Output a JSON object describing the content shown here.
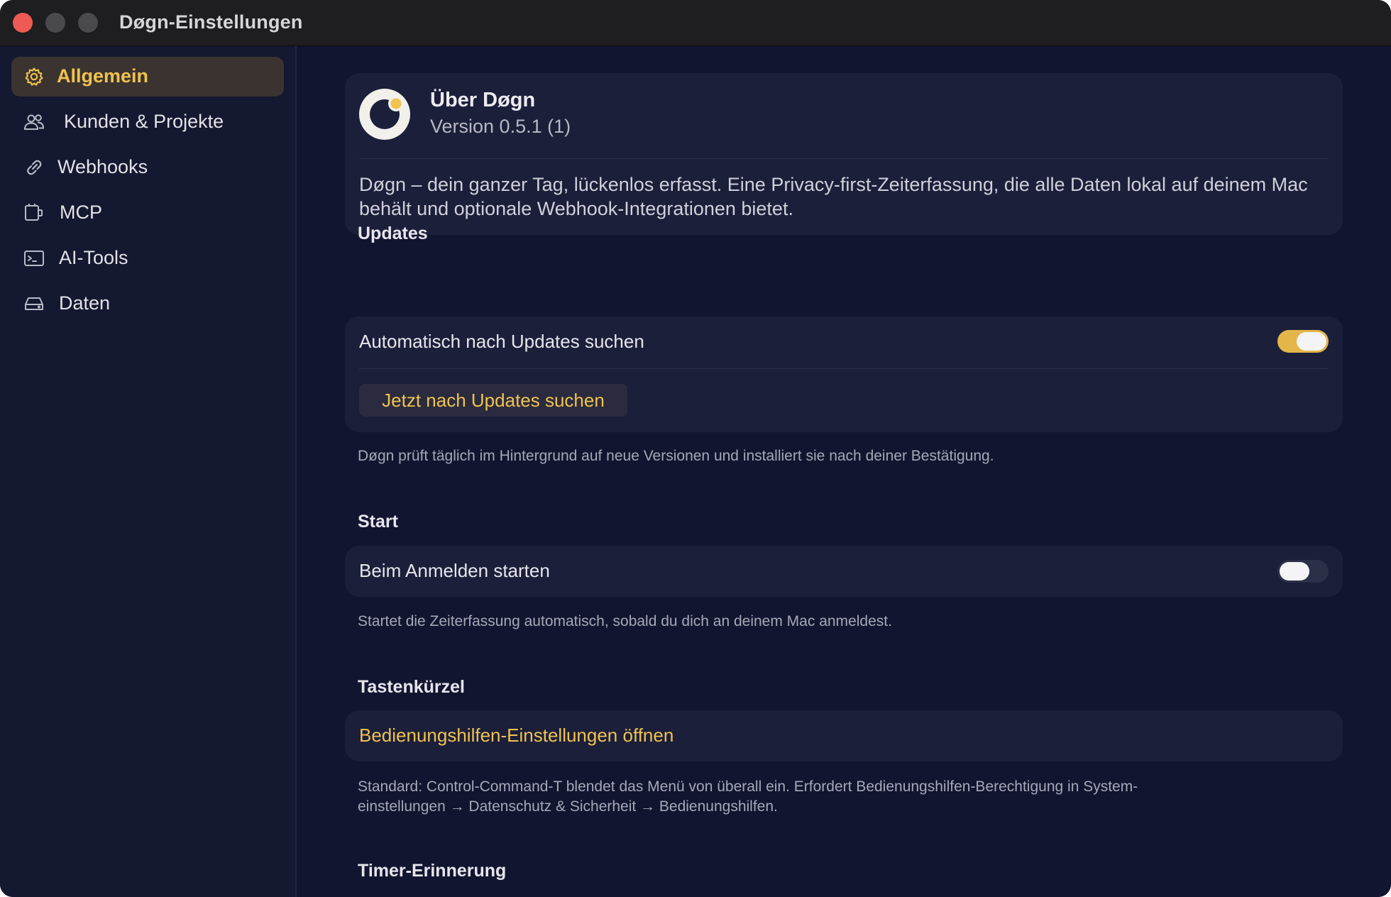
{
  "window": {
    "title": "Døgn-Einstellungen"
  },
  "sidebar": {
    "items": [
      {
        "label": "Allgemein",
        "icon": "gear-icon",
        "active": true
      },
      {
        "label": "Kunden & Projekte",
        "icon": "people-icon",
        "active": false
      },
      {
        "label": "Webhooks",
        "icon": "link-icon",
        "active": false
      },
      {
        "label": "MCP",
        "icon": "plug-icon",
        "active": false
      },
      {
        "label": "AI-Tools",
        "icon": "terminal-icon",
        "active": false
      },
      {
        "label": "Daten",
        "icon": "drive-icon",
        "active": false
      }
    ]
  },
  "about": {
    "title": "Über Døgn",
    "version": "Version 0.5.1 (1)",
    "description": "Døgn – dein ganzer Tag, lückenlos erfasst. Eine Privacy-first-Zeiterfassung, die alle Daten lokal auf deinem Mac behält und optionale Webhook-Integrationen bietet."
  },
  "updates": {
    "title": "Updates",
    "auto_label": "Automatisch nach Updates suchen",
    "auto_enabled": true,
    "check_button": "Jetzt nach Updates suchen",
    "hint": "Døgn prüft täglich im Hintergrund auf neue Versionen und installiert sie nach deiner Bestätigung."
  },
  "start": {
    "title": "Start",
    "login_label": "Beim Anmelden starten",
    "login_enabled": false,
    "hint": "Startet die Zeiterfassung automatisch, sobald du dich an deinem Mac anmeldest."
  },
  "shortcuts": {
    "title": "Tastenkürzel",
    "link": "Bedienungshilfen-Einstellungen öffnen",
    "hint_line1": "Standard: Control-Command-T blendet das Menü von überall ein. Erfordert Bedienungshilfen-Berechtigung in System-",
    "hint_line2": "einstellungen → Datenschutz & Sicherheit → Bedienungshilfen."
  },
  "timer": {
    "title": "Timer-Erinnerung"
  },
  "colors": {
    "accent": "#f0c24f",
    "background": "#121530",
    "card": "#1b1f3a"
  }
}
